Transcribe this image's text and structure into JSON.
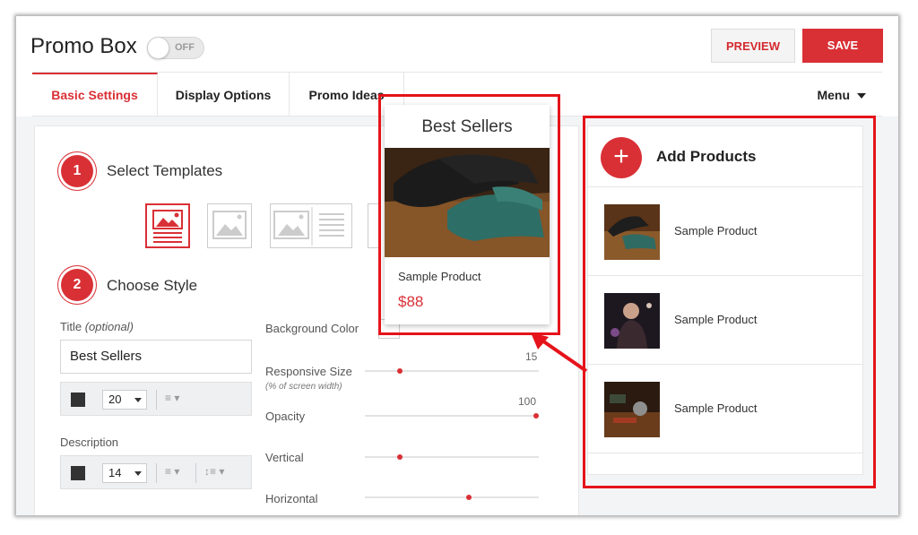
{
  "header": {
    "title": "Promo Box",
    "toggle_label": "OFF",
    "preview_label": "PREVIEW",
    "save_label": "SAVE"
  },
  "tabs": [
    {
      "label": "Basic Settings"
    },
    {
      "label": "Display Options"
    },
    {
      "label": "Promo Ideas"
    }
  ],
  "menu_label": "Menu",
  "steps": [
    {
      "number": "1",
      "label": "Select Templates"
    },
    {
      "number": "2",
      "label": "Choose Style"
    }
  ],
  "style": {
    "title_label": "Title",
    "title_optional": "(optional)",
    "title_value": "Best Sellers",
    "title_font_size": "20",
    "description_label": "Description",
    "description_font_size": "14",
    "background_color_label": "Background Color",
    "responsive_label": "Responsive Size",
    "responsive_sub": "(% of screen width)",
    "responsive_value": "15",
    "opacity_label": "Opacity",
    "opacity_value": "100",
    "vertical_label": "Vertical",
    "horizontal_label": "Horizontal"
  },
  "sliders": {
    "responsive": 0.2,
    "opacity": 1.0,
    "vertical": 0.2,
    "horizontal": 0.6
  },
  "preview_card": {
    "title": "Best Sellers",
    "product_name": "Sample Product",
    "price": "$88"
  },
  "products": {
    "add_label": "Add Products",
    "add_icon": "+",
    "items": [
      {
        "name": "Sample Product"
      },
      {
        "name": "Sample Product"
      },
      {
        "name": "Sample Product"
      }
    ]
  },
  "colors": {
    "accent": "#d93036",
    "highlight": "#e5141a"
  }
}
